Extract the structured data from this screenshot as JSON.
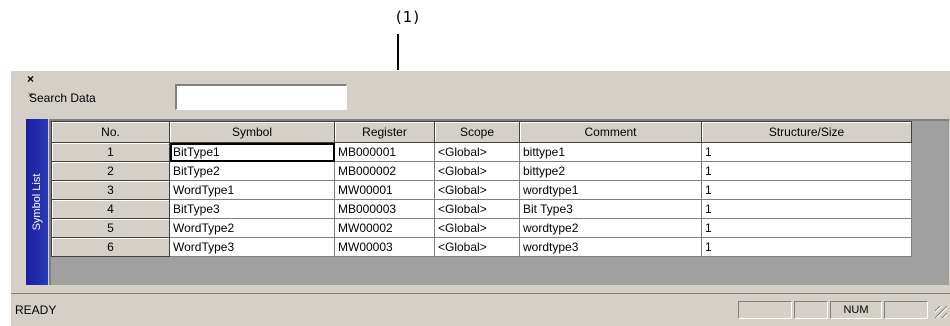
{
  "callout": {
    "label": "(1)"
  },
  "window": {
    "close_glyph": "×",
    "pin_glyph": "»",
    "tab_label": "Symbol List"
  },
  "search": {
    "label": "Search Data",
    "value": ""
  },
  "grid": {
    "columns": [
      "No.",
      "Symbol",
      "Register",
      "Scope",
      "Comment",
      "Structure/Size"
    ],
    "rows": [
      {
        "no": "1",
        "symbol": "BitType1",
        "register": "MB000001",
        "scope": "<Global>",
        "comment": "bittype1",
        "size": "1"
      },
      {
        "no": "2",
        "symbol": "BitType2",
        "register": "MB000002",
        "scope": "<Global>",
        "comment": "bittype2",
        "size": "1"
      },
      {
        "no": "3",
        "symbol": "WordType1",
        "register": "MW00001",
        "scope": "<Global>",
        "comment": "wordtype1",
        "size": "1"
      },
      {
        "no": "4",
        "symbol": "BitType3",
        "register": "MB000003",
        "scope": "<Global>",
        "comment": "Bit Type3",
        "size": "1"
      },
      {
        "no": "5",
        "symbol": "WordType2",
        "register": "MW00002",
        "scope": "<Global>",
        "comment": "wordtype2",
        "size": "1"
      },
      {
        "no": "6",
        "symbol": "WordType3",
        "register": "MW00003",
        "scope": "<Global>",
        "comment": "wordtype3",
        "size": "1"
      }
    ]
  },
  "statusbar": {
    "status": "READY",
    "panel_num": "NUM"
  },
  "colors": {
    "tab_blue": "#1c1c9c",
    "chrome": "#d4d0c8"
  }
}
